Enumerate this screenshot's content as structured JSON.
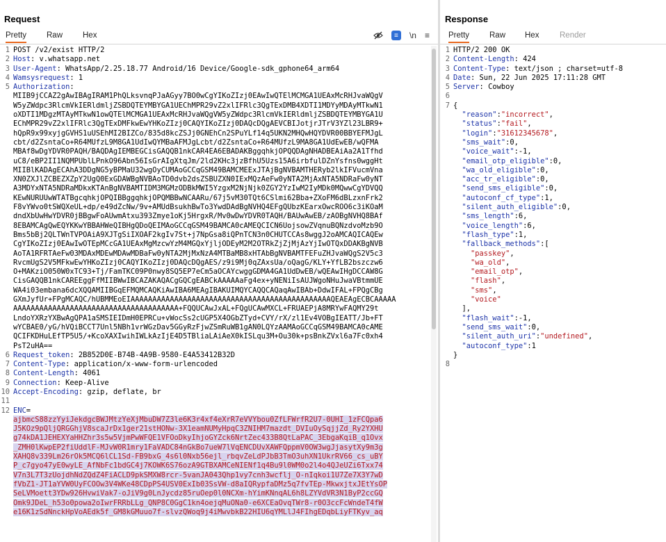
{
  "request": {
    "title": "Request",
    "tabs": [
      {
        "label": "Pretty",
        "active": true
      },
      {
        "label": "Raw"
      },
      {
        "label": "Hex"
      }
    ],
    "toolbar": {
      "newline_label": "\\n",
      "icons": [
        "eye-off-icon",
        "wrap-lines-icon",
        "newline-icon",
        "menu-icon"
      ]
    },
    "lines": [
      {
        "n": "1",
        "t": "POST /v2/exist HTTP/2"
      },
      {
        "n": "2",
        "k": "Host",
        "v": " v.whatsapp.net"
      },
      {
        "n": "3",
        "k": "User-Agent",
        "v": " WhatsApp/2.25.18.77 Android/16 Device/Google-sdk_gphone64_arm64"
      },
      {
        "n": "4",
        "k": "Wamsysrequest",
        "v": " 1"
      },
      {
        "n": "5",
        "k": "Authorization",
        "v": ""
      },
      {
        "n": "",
        "t": "MIIB9jCCAZ2gAwIBAgIRAM1PhQLksvnqPJaAGyy7BO0wCgYIKoZIzj0EAwIwQTElMCMGA1UEAxMcRHJvaWQgV"
      },
      {
        "n": "",
        "t": "W5yZWdpc3RlcmVkIERldmljZSBDQTEYMBYGA1UEChMPR29vZ2xlIFRlc3QgTExDMB4XDTI1MDYyMDAyMTkwN1"
      },
      {
        "n": "",
        "t": "oXDTI1MDgzMTAyMTkwN1owQTElMCMGA1UEAxMcRHJvaWQgVW5yZWdpc3RlcmVkIERldmljZSBDQTEYMBYGA1U"
      },
      {
        "n": "",
        "t": "EChMPR29vZ2xlIFRlc3QgTExDMFkwEwYHKoZIzj0CAQYIKoZIzj0DAQcDQgAEVCBIJotjrJTrV3YZl23LBR9+"
      },
      {
        "n": "",
        "t": "hQpR9x99xyjgGVHS1uUSEhMI2BIZCo/835d8kcZSJj0GNEhCn2SPuYLf14q5UKN2MHQwHQYDVR00BBYEFMJgL"
      },
      {
        "n": "",
        "t": "cbt/d2ZsntaCo+R64MUfzL9M8GA1UdIwQYMBaAFMJgLcbt/d2ZsntaCo+R64MUfzL9MA8GA1UdEwEB/wQFMA"
      },
      {
        "n": "",
        "t": "MBAf8wDgYDVR0PAQH/BAQDAgIEMBEGCisGAQQB1nkCAR4EA6EBADAKBggqhkjOPQQDAgNHADBEAiAa2A1Tfhd"
      },
      {
        "n": "",
        "t": "uC8/eBP2II1NQMPUblLPnkO96Abn56IsGrAIgXtqJm/2ld2KHc3jzBfhU5Uzs15A6irbfulDZnYsfns0wggHt"
      },
      {
        "n": "",
        "t": "MIIBlKADAgECAhA3DDgNG5yBPMaU32wgOyCUMAoGCCqGSM49BAMCMEExJTAjBgNVBAMTHERyb2lkIFVucmVna"
      },
      {
        "n": "",
        "t": "XN0ZXJlZCBEZXZpY2UgQ0ExGDAWBgNVBAoTD0dvb2dsZSBUZXN0IExMQzAeFw0yNTA2MjAxNTA5NDRaFw0yNT"
      },
      {
        "n": "",
        "t": "A3MDYxNTA5NDRaMDkxKTAnBgNVBAMTIDM3MGMzODBkMWI5YzgxM2NjNjk0ZGY2YzIwM2IyMDk0MQwwCgYDVQQ"
      },
      {
        "n": "",
        "t": "KEwNURUUwWTATBgcqhkjOPQIBBggqhkjOPQMBBwNCAARu/67j5vM30TQt6CSlmi62Bba+ZXoFM6dBLzxnFrk2"
      },
      {
        "n": "",
        "t": "F8vYWvo0tSWQXeUL+dp/e49dZcNw/9v+AMUdBsukhBwTo3YwdDAdBgNVHQ4EFgQUbzKEarxOwcROO6c3iKOaM"
      },
      {
        "n": "",
        "t": "dndXbUwHwYDVR0jBBgwFoAUwmAtxu393Zmye1oKj5HrgxR/Mv0wDwYDVR0TAQH/BAUwAwEB/zAOBgNVHQ8BAf"
      },
      {
        "n": "",
        "t": "8EBAMCAgQwEQYKKwYBBAHWeQIBHgQDoQEIMAoGCCqGSM49BAMCA0cAMEQCICN6UojsowZVqnuBQNzdvoMzb9O"
      },
      {
        "n": "",
        "t": "Bms5bBj2QLTWnTVPOAiA9XJTgSiIXOAF2kgIv7St+j7NpGsa8iQPnTCN3n0CHUTCCAs8wggJ2oAMCAQICAQEw"
      },
      {
        "n": "",
        "t": "CgYIKoZIzj0EAwIwOTEpMCcGA1UEAxMgMzcwYzM4MGQxYjljODEyM2M2OTRkZjZjMjAzYjIwOTQxDDAKBgNVB"
      },
      {
        "n": "",
        "t": "AoTA1RFRTAeFw03MDAxMDEwMDAwMDBaFw0yNTA2MjMxNzA4MTBaMB8xHTAbBgNVBAMTFEFuZHJvaWQgS2V5c3"
      },
      {
        "n": "",
        "t": "RvcmUgS2V5MFkwEwYHKoZIzj0CAQYIKoZIzj0DAQcDQgAES/z9i9Mj0qZAxsUa/oQagG/KLY+YfLB2bszczw6"
      },
      {
        "n": "",
        "t": "O+MAKziO050W0xTC93+Tj/FamTKC09P0nwy8SQ5EP7eCm5aOCAYcwggGDMA4GA1UdDwEB/wQEAwIHgDCCAW8G"
      },
      {
        "n": "",
        "t": "CisGAQQB1nkCAREEggFfMIIBWwIBCAZAKAQACgGQCgEABCkAAAAAaFg4ex+yNENiIsAUJWgoNHuJwaVBtmmUE"
      },
      {
        "n": "",
        "t": "WA4i03embana6dcXQQAMIIBGqEFMQMCAQKiAwIBA6MEAgIBAKUIMQYCAQQCAQaqAwIBAb+DdwIFAL+FPQgCBg"
      },
      {
        "n": "",
        "t": "GXmJyfUr+FPgMCAQC/hUBMMEoEIAAAAAAAAAAAAAAAAAAAAAAAAAAAAAAAAAAAAAAAAAAAAAAQEAEAgECBCAAAAA"
      },
      {
        "n": "",
        "t": "AAAAAAAAAAAAAAAAAAAAAAAAAAAAAAAAAAAAAA+FQQUCAwJxAL+FQgUCAwMXCL+FRUAEPjA8MRYwFAQMY29t"
      },
      {
        "n": "",
        "t": "LndoYXRzYXBwAgQPA1aSMSIEIDmH0EPRCu+vWocSs2cUGP5X4OGbZTyd+CVY/rX/zl1Ev4VOBgIEATT/Jb+FT"
      },
      {
        "n": "",
        "t": "wYCBAE0/yG/hVQiBCCT7Unl5NBh1vrWGzDav5GGyRzFjwZSmRuWB1gAN0LQYzAAMAoGCCqGSM49BAMCA0cAME"
      },
      {
        "n": "",
        "t": "QCIFKDHuLEfTP5U5/+KcoXAXIwihIWLkAzIjE4D5TBliaLAiAeX0kISLqu3M+Ou30k+psBnkZVxl6a7Fc0xh4"
      },
      {
        "n": "",
        "t": "PsT2uHA=="
      },
      {
        "n": "6",
        "k": "Request_token",
        "v": " 2B852D0E-B74B-4A9B-9580-E4A53412B32D"
      },
      {
        "n": "7",
        "k": "Content-Type",
        "v": " application/x-www-form-urlencoded"
      },
      {
        "n": "8",
        "k": "Content-Length",
        "v": " 4061"
      },
      {
        "n": "9",
        "k": "Connection",
        "v": " Keep-Alive"
      },
      {
        "n": "10",
        "k": "Accept-Encoding",
        "v": " gzip, deflate, br"
      },
      {
        "n": "11",
        "t": ""
      },
      {
        "n": "12",
        "k2": "ENC",
        "v": "="
      },
      {
        "n": "",
        "h": "ajbmcS88zzYyiJekdgcBWJMtzYeXjMbuDW7Z3le6K3r4xf4eXrR7eVVYbou0ZfLFWrfR2U7-0UHI_1zFCQpa6"
      },
      {
        "n": "",
        "h": "J5KOz9pQljQRGGhjV8scaJrDx1ger21stHONw-3X1eamNUMyHpqC3ZNIHM7mazdt_DVIuOySqjjZd_Ry2YXHU"
      },
      {
        "n": "",
        "h": "g74kDA1JEHEXYaHHZhr3s5w5VjmPwWFQE1VFOoDkyIhjoGYZck6NrtZec433B8QtLaPAC_3EbgaKqiB_q1Ovx"
      },
      {
        "n": "",
        "h": "_ZMH0lKwpEP2fiUddlF-MJvW0R1mry1FaVADC84nGkBo7ueW7lVqENCDUvXAWFQppmV0OW3wgJjasytXy9m3g"
      },
      {
        "n": "",
        "h": "XAHQ8v339Lm26rOk5MCQ6lCL1Sd-FB9bxG_4s6l0Nxb56ejl_rbqvZeLdPJbB3TmO3uhXN1UkrRV66_cs_uBY"
      },
      {
        "n": "",
        "h": "P_c7gyo47yE0wyLE_AfNbFc1bdGC4j7KOWK6S76ozA9GTBXAMCeNIENf1q4Bu9l0WM0o2l4o4QJeUZi6Txx74"
      },
      {
        "n": "",
        "h": "V7n3L7T3zUojdhNdZQdZ4FiACLD9pkSMXW8rcr-5vanJA043Qhp1vy7cnh3wcflj_O-nIqkoi1U7Ze7X3Y7wD"
      },
      {
        "n": "",
        "h": "fVbZ1-JT1aYVW0UyFCOOw3V4WKe48CDpPS4USV0ExIb03SsVW-d8aIQRypfaDMz5q7fvTEp-MkwxjtxJEtYsOP"
      },
      {
        "n": "",
        "h": "SeLVMoett3YDw926HvwiVak7-oJiV9g0LnJycdz85ruOep0l0NCXm-hYimKNnqAL6h8LZYVdVR3N1ByP2ccGQ"
      },
      {
        "n": "",
        "h": "Omk9JDeL_h53o0powa2oIwrFRRbLLg_QNP8C0GgC1kn4oejqMuONa0-e6XCEaOvqTWr8-r0O3ccFcWndeT4fW"
      },
      {
        "n": "",
        "h": "e16K1zSdNnckHpVoAEdk5f_GM8kGMuuo7f-slvzQWoq9j4iMwvbkB22HIU6qYMLlJ4FIhgEDqbLiyFTKyv_aq"
      }
    ]
  },
  "response": {
    "title": "Response",
    "tabs": [
      {
        "label": "Pretty",
        "active": true
      },
      {
        "label": "Raw"
      },
      {
        "label": "Hex"
      },
      {
        "label": "Render",
        "disabled": true
      }
    ],
    "lines": [
      {
        "n": "1",
        "t": "HTTP/2 200 OK"
      },
      {
        "n": "2",
        "k": "Content-Length",
        "v": " 424"
      },
      {
        "n": "3",
        "k": "Content-Type",
        "v": " text/json ; charset=utf-8"
      },
      {
        "n": "4",
        "k": "Date",
        "v": " Sun, 22 Jun 2025 17:11:28 GMT"
      },
      {
        "n": "5",
        "k": "Server",
        "v": " Cowboy"
      },
      {
        "n": "6",
        "t": ""
      },
      {
        "n": "7",
        "t": "{"
      },
      {
        "n": "",
        "jk": "reason",
        "jv": "\"incorrect\"",
        "c": ","
      },
      {
        "n": "",
        "jk": "status",
        "jv": "\"fail\"",
        "c": ","
      },
      {
        "n": "",
        "jk": "login",
        "jv": "\"31612345678\"",
        "c": ","
      },
      {
        "n": "",
        "jk": "sms_wait",
        "jn": "0",
        "c": ","
      },
      {
        "n": "",
        "jk": "voice_wait",
        "jn": "-1",
        "c": ","
      },
      {
        "n": "",
        "jk": "email_otp_eligible",
        "jn": "0",
        "c": ","
      },
      {
        "n": "",
        "jk": "wa_old_eligible",
        "jn": "0",
        "c": ","
      },
      {
        "n": "",
        "jk": "acc_tr_eligible",
        "jn": "0",
        "c": ","
      },
      {
        "n": "",
        "jk": "send_sms_eligible",
        "jn": "0",
        "c": ","
      },
      {
        "n": "",
        "jk": "autoconf_cf_type",
        "jn": "1",
        "c": ","
      },
      {
        "n": "",
        "jk": "silent_auth_eligible",
        "jn": "0",
        "c": ","
      },
      {
        "n": "",
        "jk": "sms_length",
        "jn": "6",
        "c": ","
      },
      {
        "n": "",
        "jk": "voice_length",
        "jn": "6",
        "c": ","
      },
      {
        "n": "",
        "jk": "flash_type",
        "jn": "1",
        "c": ","
      },
      {
        "n": "",
        "jk": "fallback_methods",
        "jn": "[",
        "c": ""
      },
      {
        "n": "",
        "ind": "    ",
        "js": "\"passkey\"",
        "c": ","
      },
      {
        "n": "",
        "ind": "    ",
        "js": "\"wa_old\"",
        "c": ","
      },
      {
        "n": "",
        "ind": "    ",
        "js": "\"email_otp\"",
        "c": ","
      },
      {
        "n": "",
        "ind": "    ",
        "js": "\"flash\"",
        "c": ","
      },
      {
        "n": "",
        "ind": "    ",
        "js": "\"sms\"",
        "c": ","
      },
      {
        "n": "",
        "ind": "    ",
        "js": "\"voice\"",
        "c": ""
      },
      {
        "n": "",
        "t": "  ],"
      },
      {
        "n": "",
        "jk": "flash_wait",
        "jn": "-1",
        "c": ","
      },
      {
        "n": "",
        "jk": "send_sms_wait",
        "jn": "0",
        "c": ","
      },
      {
        "n": "",
        "jk": "silent_auth_uri",
        "jv": "\"undefined\"",
        "c": ","
      },
      {
        "n": "",
        "jk": "autoconf_type",
        "jn": "1",
        "c": ""
      },
      {
        "n": "",
        "t": "}"
      },
      {
        "n": "8",
        "t": ""
      }
    ]
  }
}
